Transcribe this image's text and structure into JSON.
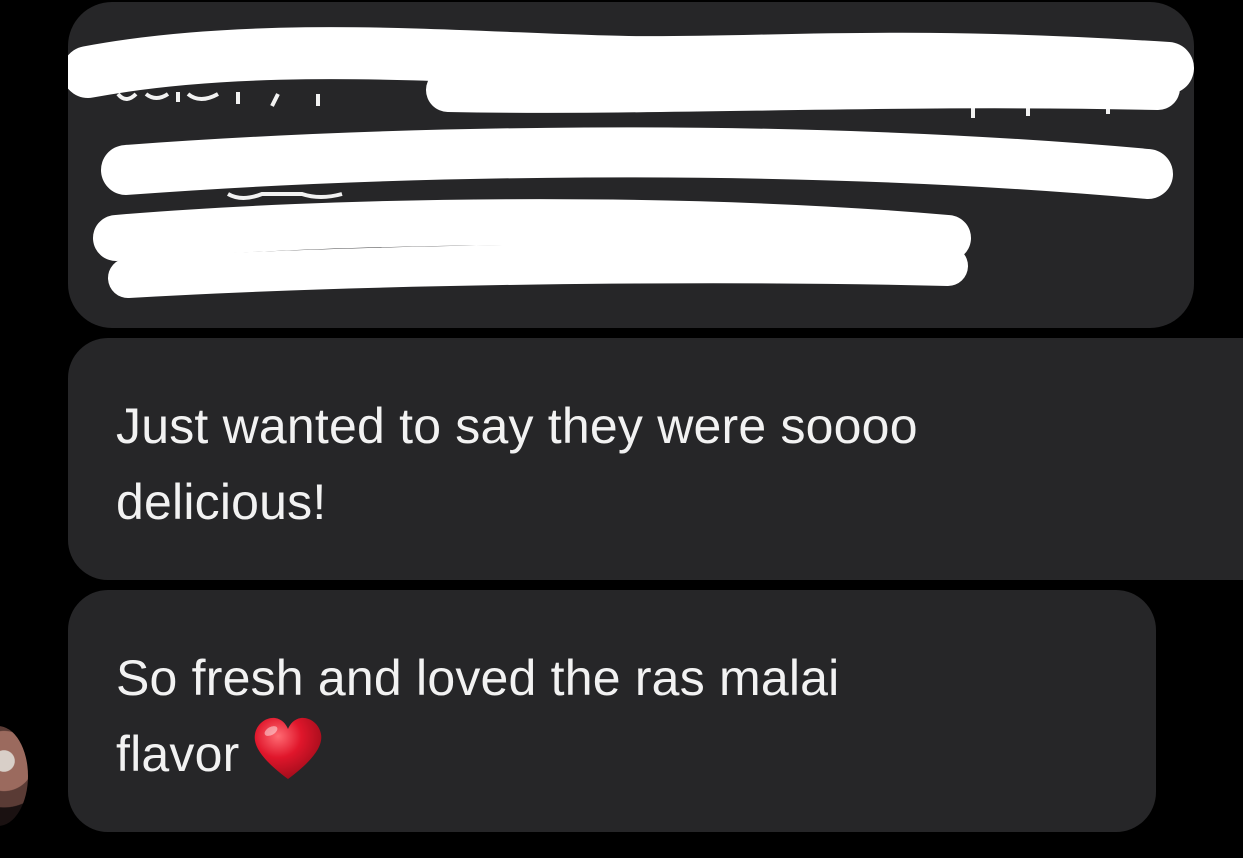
{
  "conversation": {
    "messages": [
      {
        "id": "redacted-message",
        "redacted": true,
        "text": ""
      },
      {
        "id": "message-2",
        "lines": [
          "Just wanted to say they were soooo",
          "delicious!"
        ]
      },
      {
        "id": "message-3",
        "lines": [
          "So fresh and loved the ras malai",
          "flavor"
        ],
        "trailing_emoji": "heart-icon"
      }
    ]
  },
  "colors": {
    "background": "#000000",
    "bubble": "#262628",
    "text": "#f2f2f2",
    "redaction": "#ffffff",
    "heart": "#e0162b"
  }
}
